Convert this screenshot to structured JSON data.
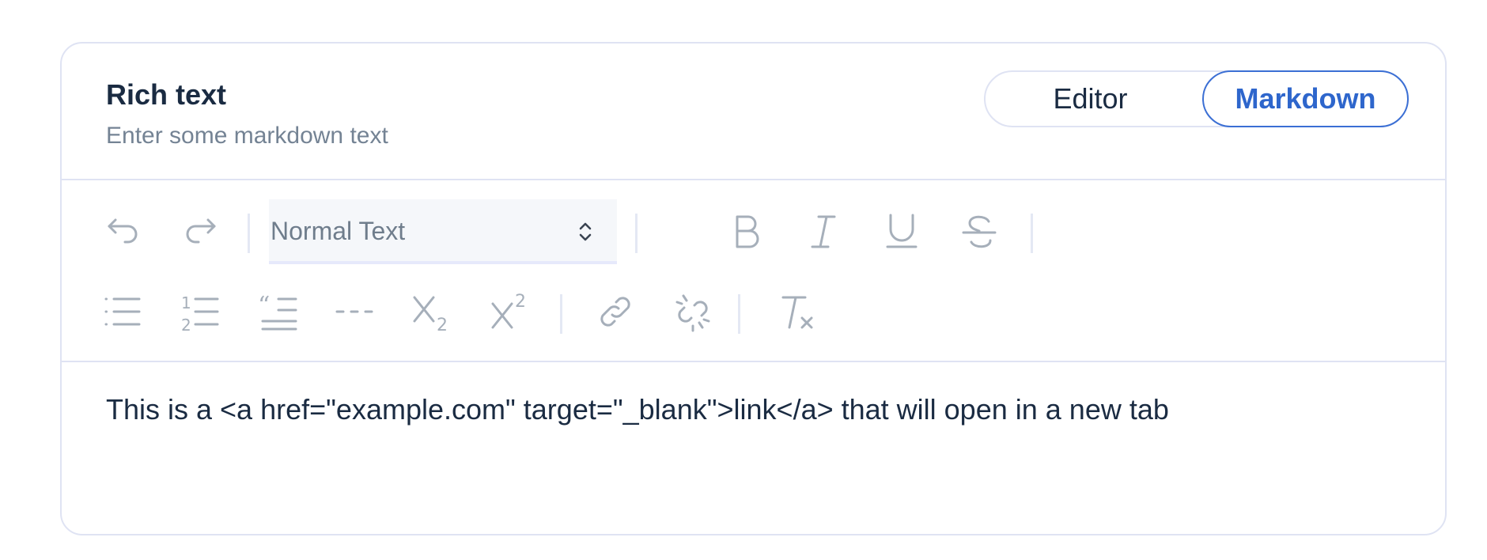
{
  "header": {
    "title": "Rich text",
    "subtitle": "Enter some markdown text"
  },
  "mode_toggle": {
    "options": [
      "Editor",
      "Markdown"
    ],
    "selected": "Markdown"
  },
  "toolbar": {
    "block_type": {
      "value": "Normal Text"
    },
    "row1": [
      "undo-icon",
      "redo-icon",
      "bold-icon",
      "italic-icon",
      "underline-icon",
      "strikethrough-icon"
    ],
    "row2": [
      "bullet-list-icon",
      "numbered-list-icon",
      "blockquote-icon",
      "horizontal-rule-icon",
      "subscript-icon",
      "superscript-icon",
      "link-icon",
      "unlink-icon",
      "clear-formatting-icon"
    ]
  },
  "editor": {
    "content": "This is a <a href=\"example.com\" target=\"_blank\">link</a> that will open in a new tab"
  },
  "colors": {
    "accent": "#2e66cc",
    "border": "#dfe3f3",
    "icon": "#a6afba",
    "text": "#1a2b42",
    "muted": "#748394"
  }
}
